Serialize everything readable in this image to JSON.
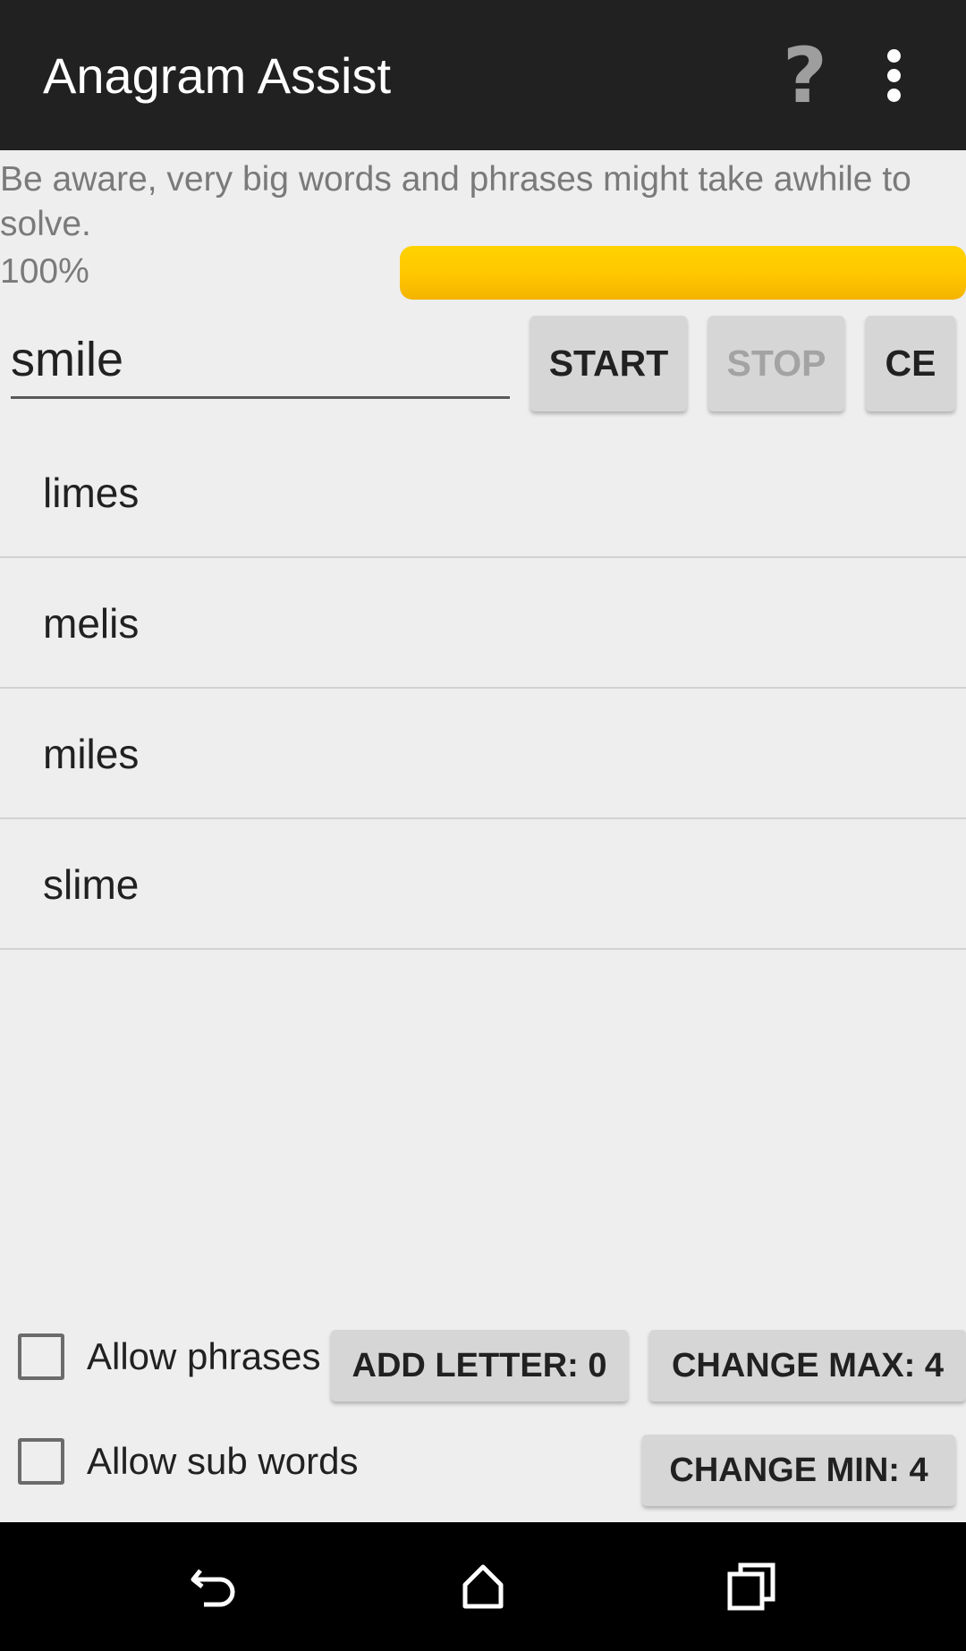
{
  "app_bar": {
    "title": "Anagram Assist",
    "help_glyph": "?",
    "help_icon": "help-icon",
    "menu_icon": "overflow-menu-icon"
  },
  "warning_text": "Be aware, very big words and phrases might take awhile to solve.",
  "progress": {
    "label": "100%",
    "value": 1.0,
    "color": "#ffc800"
  },
  "input": {
    "value": "smile"
  },
  "buttons": {
    "start": "START",
    "stop": "STOP",
    "ce": "CE",
    "add_letter": "ADD LETTER: 0",
    "change_max": "CHANGE MAX: 4",
    "change_min": "CHANGE MIN: 4"
  },
  "results": [
    "limes",
    "melis",
    "miles",
    "slime"
  ],
  "options": {
    "allow_phrases": {
      "label": "Allow phrases",
      "checked": false
    },
    "allow_sub_words": {
      "label": "Allow sub words",
      "checked": false
    }
  },
  "nav_bar": {
    "back_icon": "back-icon",
    "home_icon": "home-icon",
    "recents_icon": "recent-apps-icon"
  },
  "colors": {
    "app_bar": "#212121",
    "background": "#eeeeee",
    "button": "#d6d6d6",
    "progress": "#ffc800"
  }
}
